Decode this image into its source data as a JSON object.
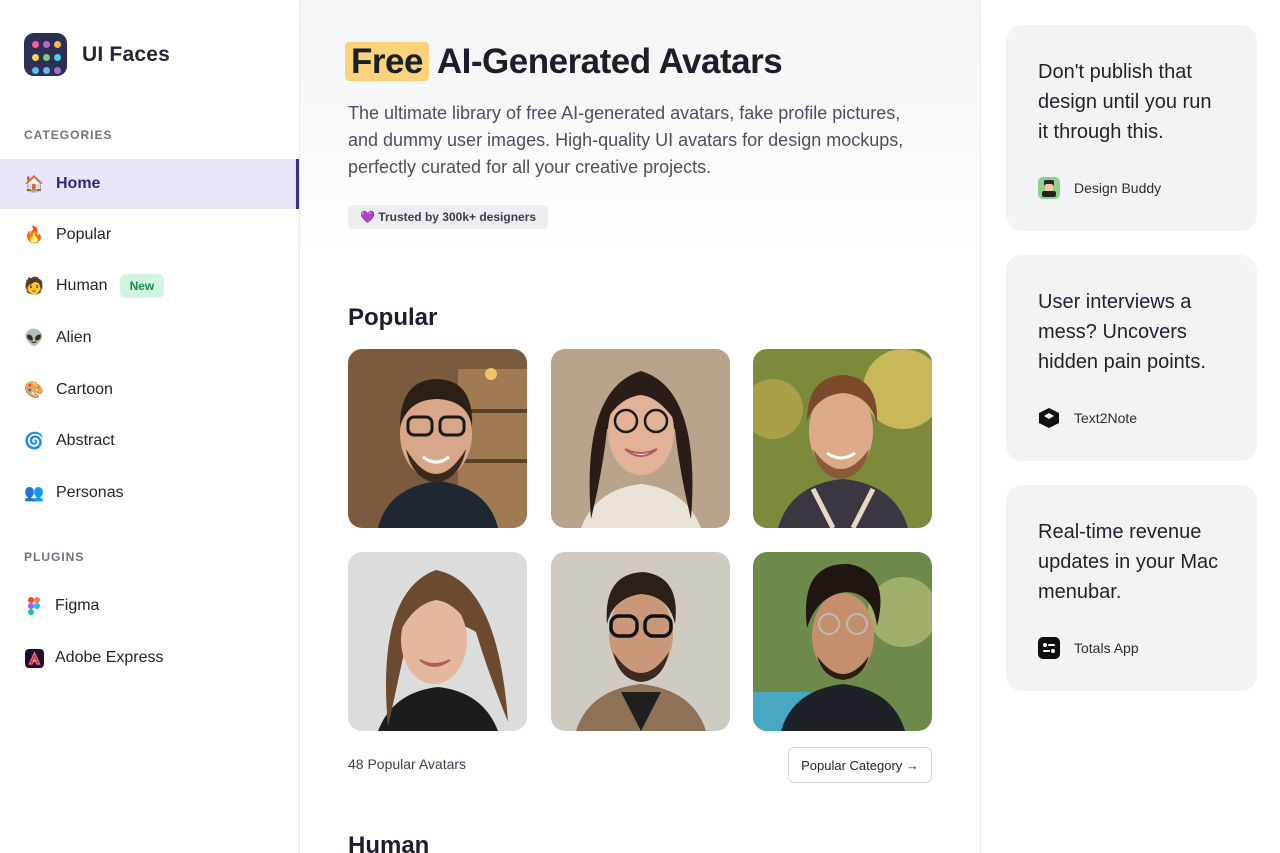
{
  "app": {
    "name": "UI Faces"
  },
  "sidebar": {
    "categories_label": "CATEGORIES",
    "items": [
      {
        "label": "Home",
        "emoji": "🏠",
        "active": true
      },
      {
        "label": "Popular",
        "emoji": "🔥"
      },
      {
        "label": "Human",
        "emoji": "🧑",
        "badge": "New"
      },
      {
        "label": "Alien",
        "emoji": "👽"
      },
      {
        "label": "Cartoon",
        "emoji": "🎨"
      },
      {
        "label": "Abstract",
        "emoji": "🌀"
      },
      {
        "label": "Personas",
        "emoji": "👥"
      }
    ],
    "plugins_label": "PLUGINS",
    "plugins": [
      {
        "label": "Figma",
        "icon": "figma-icon"
      },
      {
        "label": "Adobe Express",
        "icon": "adobe-express-icon"
      }
    ]
  },
  "hero": {
    "highlight": "Free",
    "title_rest": "AI-Generated Avatars",
    "subtitle": "The ultimate library of free AI-generated avatars, fake profile pictures, and dummy user images. High-quality UI avatars for design mockups, perfectly curated for all your creative projects.",
    "trust_emoji": "💜",
    "trust": "Trusted by 300k+ designers"
  },
  "popular": {
    "title": "Popular",
    "count_label": "48 Popular Avatars",
    "button": "Popular Category →"
  },
  "human": {
    "title": "Human"
  },
  "ads": [
    {
      "text": "Don't publish that design until you run it through this.",
      "brand": "Design Buddy",
      "icon": "design-buddy-icon"
    },
    {
      "text": "User interviews a mess? Uncovers hidden pain points.",
      "brand": "Text2Note",
      "icon": "text2note-icon"
    },
    {
      "text": "Real-time revenue updates in your Mac menubar.",
      "brand": "Totals App",
      "icon": "totals-app-icon"
    }
  ],
  "colors": {
    "accent": "#3a2f8c",
    "active_bg": "#e9e6fb",
    "highlight": "#f8d37a",
    "badge_bg": "#d2f5e2",
    "badge_text": "#1c8a52"
  }
}
